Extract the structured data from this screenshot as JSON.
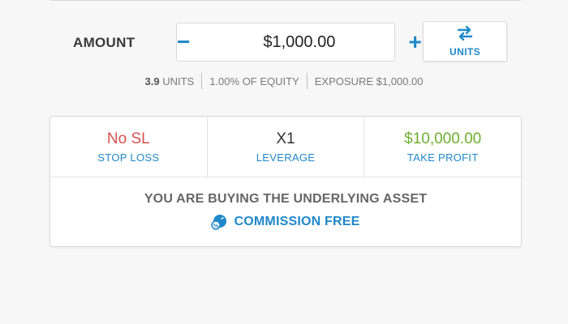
{
  "amount": {
    "label": "AMOUNT",
    "value": "$1,000.00",
    "minus_glyph": "−",
    "plus_glyph": "+"
  },
  "units_toggle": {
    "icon": "swap-arrows-icon",
    "label": "UNITS"
  },
  "info": {
    "units_value": "3.9",
    "units_suffix": " UNITS",
    "equity": "1.00% OF EQUITY",
    "exposure": "EXPOSURE $1,000.00"
  },
  "order": {
    "stop_loss": {
      "value": "No SL",
      "label": "STOP LOSS",
      "color": "#d9534f"
    },
    "leverage": {
      "value": "X1",
      "label": "LEVERAGE",
      "color": "#333333"
    },
    "take_profit": {
      "value": "$10,000.00",
      "label": "TAKE PROFIT",
      "color": "#6fae2f"
    }
  },
  "footer": {
    "buying_text": "YOU ARE BUYING THE UNDERLYING ASSET",
    "commission_icon": "commission-percent-icon",
    "commission_text": "COMMISSION FREE"
  },
  "colors": {
    "accent": "#1f88c9",
    "stop_loss_red": "#d9534f",
    "take_profit_green": "#6fae2f"
  }
}
